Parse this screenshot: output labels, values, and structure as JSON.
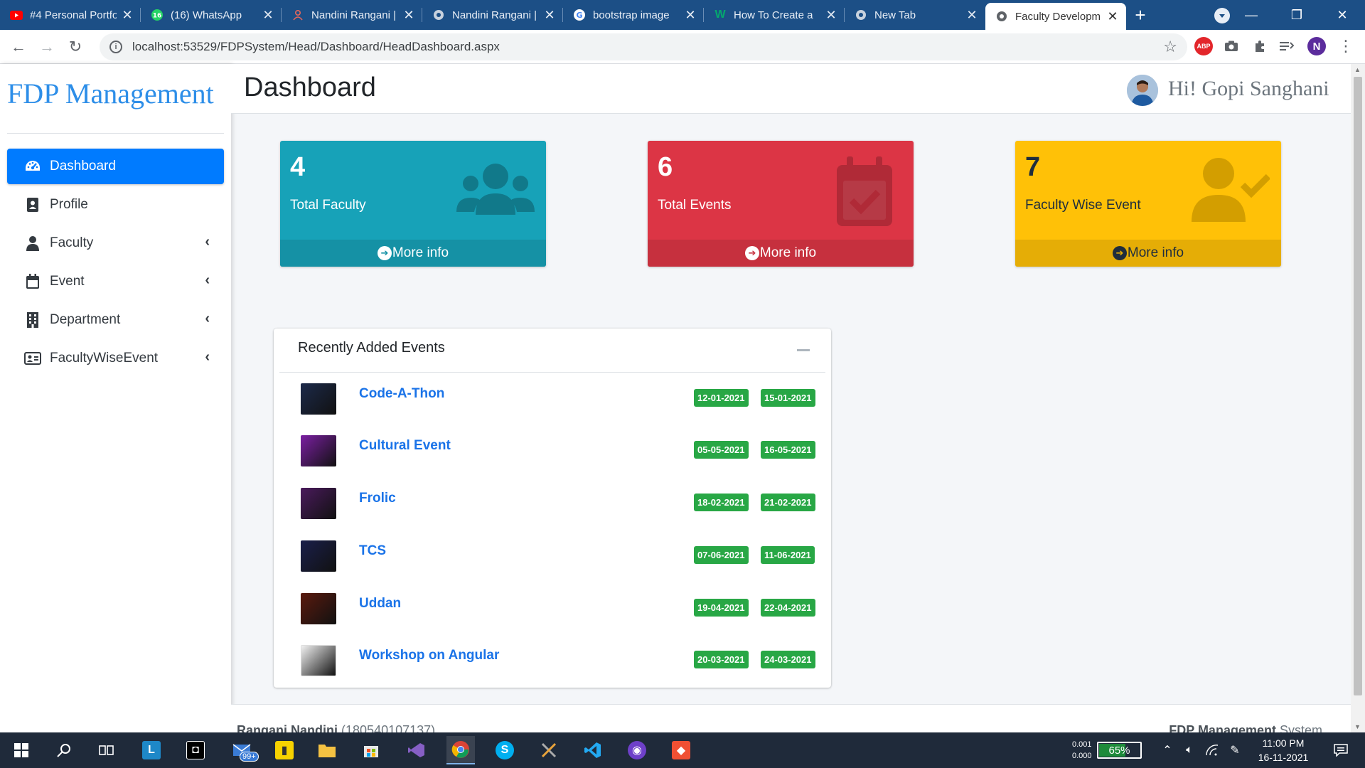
{
  "browser": {
    "tabs": [
      {
        "title": "#4 Personal Portfo",
        "icon": "youtube-icon",
        "color": "#ff0000"
      },
      {
        "title": "(16) WhatsApp",
        "icon": "whatsapp-icon",
        "color": "#25d366"
      },
      {
        "title": "Nandini Rangani |",
        "icon": "person-icon",
        "color": "#e8675a"
      },
      {
        "title": "Nandini Rangani |",
        "icon": "globe-icon",
        "color": "#c8d2de"
      },
      {
        "title": "bootstrap image",
        "icon": "google-icon",
        "color": "#ffffff"
      },
      {
        "title": "How To Create a",
        "icon": "w3schools-icon",
        "color": "#04aa6d"
      },
      {
        "title": "New Tab",
        "icon": "globe-icon",
        "color": "#c8d2de"
      },
      {
        "title": "Faculty Developm",
        "icon": "globe-icon",
        "color": "#5f6368",
        "active": true
      }
    ],
    "url": "localhost:53529/FDPSystem/Head/Dashboard/HeadDashboard.aspx",
    "profile_initial": "N",
    "abp_label": "ABP"
  },
  "sidebar": {
    "brand": "FDP Management",
    "items": [
      {
        "label": "Dashboard",
        "icon": "speedometer-icon",
        "active": true,
        "has_submenu": false
      },
      {
        "label": "Profile",
        "icon": "id-badge-icon",
        "active": false,
        "has_submenu": false
      },
      {
        "label": "Faculty",
        "icon": "user-icon",
        "active": false,
        "has_submenu": true
      },
      {
        "label": "Event",
        "icon": "calendar-icon",
        "active": false,
        "has_submenu": true
      },
      {
        "label": "Department",
        "icon": "building-icon",
        "active": false,
        "has_submenu": true
      },
      {
        "label": "FacultyWiseEvent",
        "icon": "id-card-icon",
        "active": false,
        "has_submenu": true
      }
    ]
  },
  "header": {
    "title": "Dashboard",
    "greeting": "Hi! Gopi Sanghani"
  },
  "stats": [
    {
      "value": "4",
      "label": "Total Faculty",
      "more": "More info",
      "icon": "users-icon",
      "bg": "#17a2b8",
      "footer_bg": "#1591a5",
      "text_color": "#ffffff",
      "icon_color": "#11798a"
    },
    {
      "value": "6",
      "label": "Total Events",
      "more": "More info",
      "icon": "calendar-check-icon",
      "bg": "#dc3545",
      "footer_bg": "#c6303e",
      "text_color": "#ffffff",
      "icon_color": "#b02a37"
    },
    {
      "value": "7",
      "label": "Faculty Wise Event",
      "more": "More info",
      "icon": "user-check-icon",
      "bg": "#ffc107",
      "footer_bg": "#e5ad06",
      "text_color": "#1f2d3d",
      "icon_color": "#d39e00"
    }
  ],
  "events": {
    "title": "Recently Added Events",
    "items": [
      {
        "name": "Code-A-Thon",
        "start": "12-01-2021",
        "end": "15-01-2021",
        "thumb": "#1c2a4a"
      },
      {
        "name": "Cultural Event",
        "start": "05-05-2021",
        "end": "16-05-2021",
        "thumb": "#7b1fa2"
      },
      {
        "name": "Frolic",
        "start": "18-02-2021",
        "end": "21-02-2021",
        "thumb": "#4a1a5c"
      },
      {
        "name": "TCS",
        "start": "07-06-2021",
        "end": "11-06-2021",
        "thumb": "#1a1f4a"
      },
      {
        "name": "Uddan",
        "start": "19-04-2021",
        "end": "22-04-2021",
        "thumb": "#5a1a0e"
      },
      {
        "name": "Workshop on Angular",
        "start": "20-03-2021",
        "end": "24-03-2021",
        "thumb": "#f1f1f1"
      }
    ]
  },
  "footer": {
    "left_name": "Rangani Nandini",
    "left_id": "(180540107137)",
    "right_bold": "FDP Management",
    "right_text": "System"
  },
  "taskbar": {
    "notif_badge": "99+",
    "net_up": "0.001",
    "net_down": "0.000",
    "battery": "65%",
    "battery_level": 0.65,
    "time": "11:00 PM",
    "date": "16-11-2021"
  },
  "colors": {
    "primary": "#007bff",
    "success": "#28a745",
    "brand": "#2d8ee8"
  }
}
